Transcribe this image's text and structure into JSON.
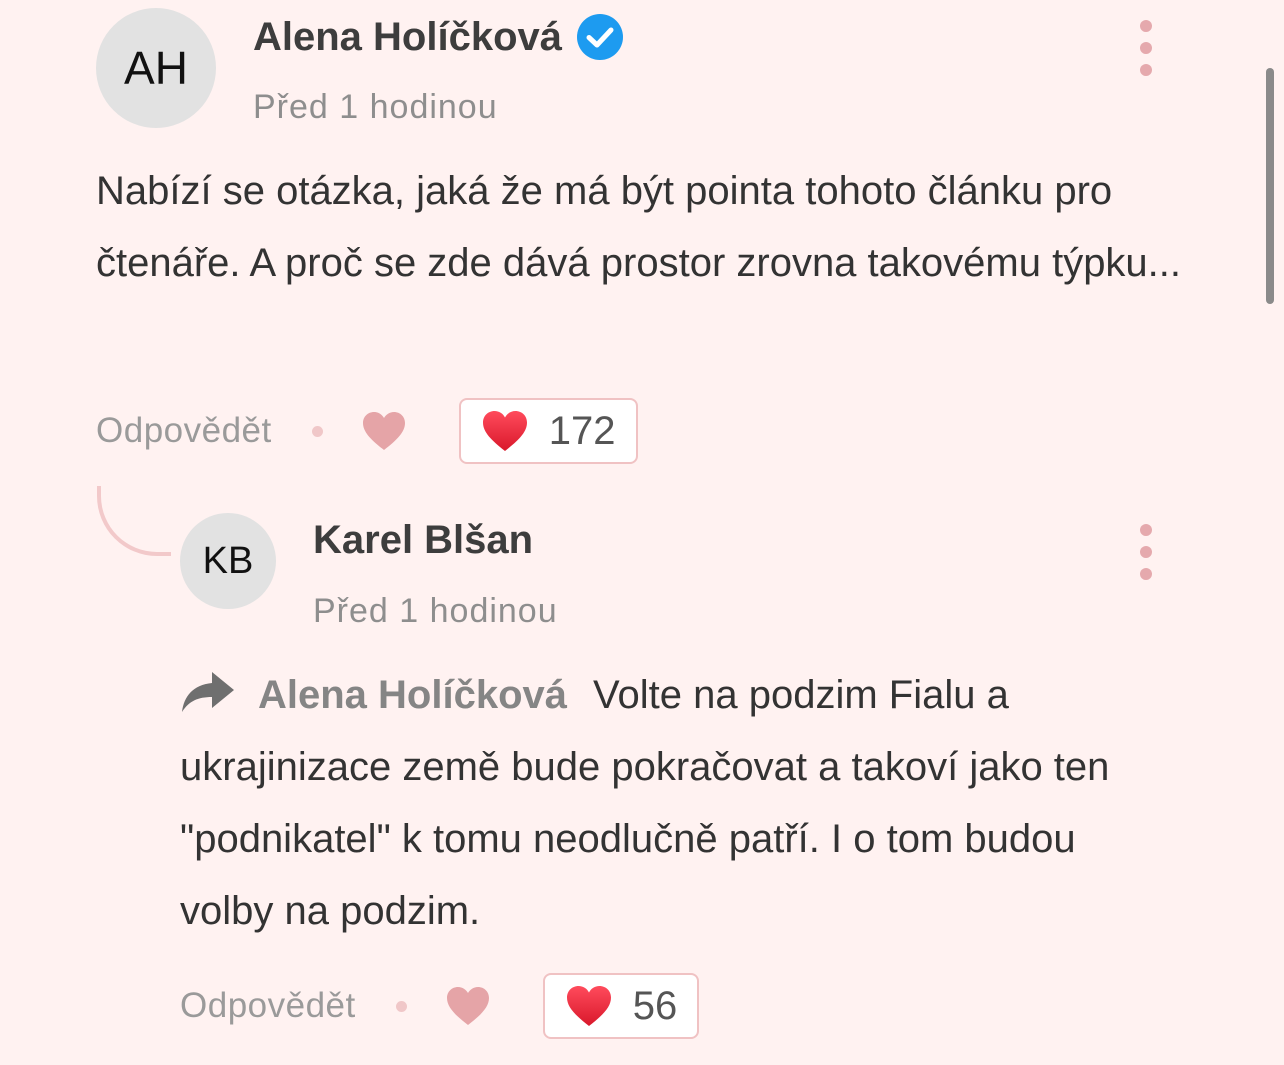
{
  "comments": [
    {
      "initials": "AH",
      "author": "Alena Holíčková",
      "verified": true,
      "time": "Před 1 hodinou",
      "text": "Nabízí se otázka, jaká že má být pointa tohoto článku pro čtenáře. A proč se zde dává prostor zrovna takovému týpku...",
      "reply_label": "Odpovědět",
      "likes": "172"
    },
    {
      "initials": "KB",
      "author": "Karel Blšan",
      "verified": false,
      "time": "Před 1 hodinou",
      "reply_to": "Alena Holíčková",
      "text": "Volte na podzim Fialu a ukrajinizace země bude pokračovat a takoví jako ten \"podnikatel\" k tomu neodlučně patří. I o tom budou volby na podzim.",
      "reply_label": "Odpovědět",
      "likes": "56"
    }
  ],
  "colors": {
    "background": "#fff2f1",
    "accent_pink": "#e5a9ad",
    "heart_red": "#e8283c",
    "verified_blue": "#1d9bf0"
  },
  "icons": [
    "verified-badge-icon",
    "more-options-icon",
    "heart-icon",
    "reply-arrow-icon"
  ]
}
